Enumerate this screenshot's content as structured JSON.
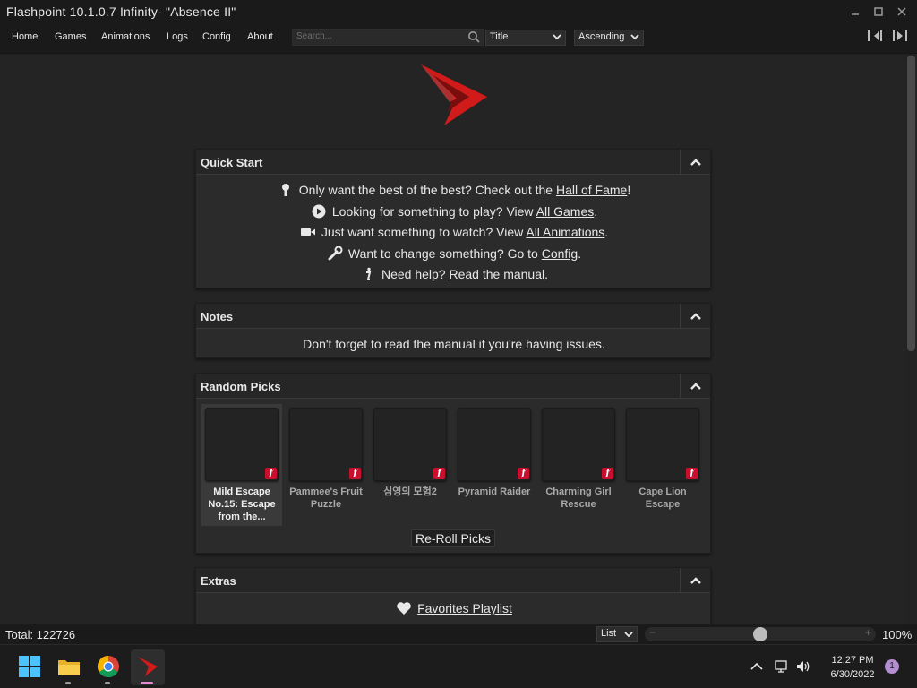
{
  "window": {
    "title": "Flashpoint 10.1.0.7 Infinity- \"Absence II\"",
    "controls": [
      "minimize",
      "maximize",
      "close"
    ]
  },
  "nav": {
    "items": [
      "Home",
      "Games",
      "Animations",
      "Logs",
      "Config",
      "About"
    ],
    "search_placeholder": "Search...",
    "sort_field": "Title",
    "sort_order": "Ascending"
  },
  "quick_start": {
    "title": "Quick Start",
    "lines": [
      {
        "icon": "lightbulb-icon",
        "pre": "Only want the best of the best? Check out the ",
        "link": "Hall of Fame",
        "post": "!"
      },
      {
        "icon": "play-circle-icon",
        "pre": "Looking for something to play? View ",
        "link": "All Games",
        "post": "."
      },
      {
        "icon": "video-camera-icon",
        "pre": "Just want something to watch? View ",
        "link": "All Animations",
        "post": "."
      },
      {
        "icon": "wrench-icon",
        "pre": "Want to change something? Go to ",
        "link": "Config",
        "post": "."
      },
      {
        "icon": "info-icon",
        "pre": "Need help? ",
        "link": "Read the manual",
        "post": "."
      }
    ]
  },
  "notes": {
    "title": "Notes",
    "text": "Don't forget to read the manual if you're having issues."
  },
  "random_picks": {
    "title": "Random Picks",
    "picks": [
      {
        "name": "Mild Escape No.15: Escape from the...",
        "selected": true
      },
      {
        "name": "Pammee's Fruit Puzzle",
        "selected": false
      },
      {
        "name": "심영의 모험2",
        "selected": false
      },
      {
        "name": "Pyramid Raider",
        "selected": false
      },
      {
        "name": "Charming Girl Rescue",
        "selected": false
      },
      {
        "name": "Cape Lion Escape",
        "selected": false
      }
    ],
    "reroll_label": "Re-Roll Picks"
  },
  "extras": {
    "title": "Extras",
    "link": "Favorites Playlist"
  },
  "status": {
    "total": "Total: 122726",
    "view": "List",
    "zoom": "100%",
    "zoom_fraction": 0.5
  },
  "taskbar": {
    "time": "12:27 PM",
    "date": "6/30/2022",
    "notifications": "1"
  },
  "colors": {
    "accent": "#c8102e",
    "background": "#242424",
    "panel": "#2b2b2b"
  }
}
